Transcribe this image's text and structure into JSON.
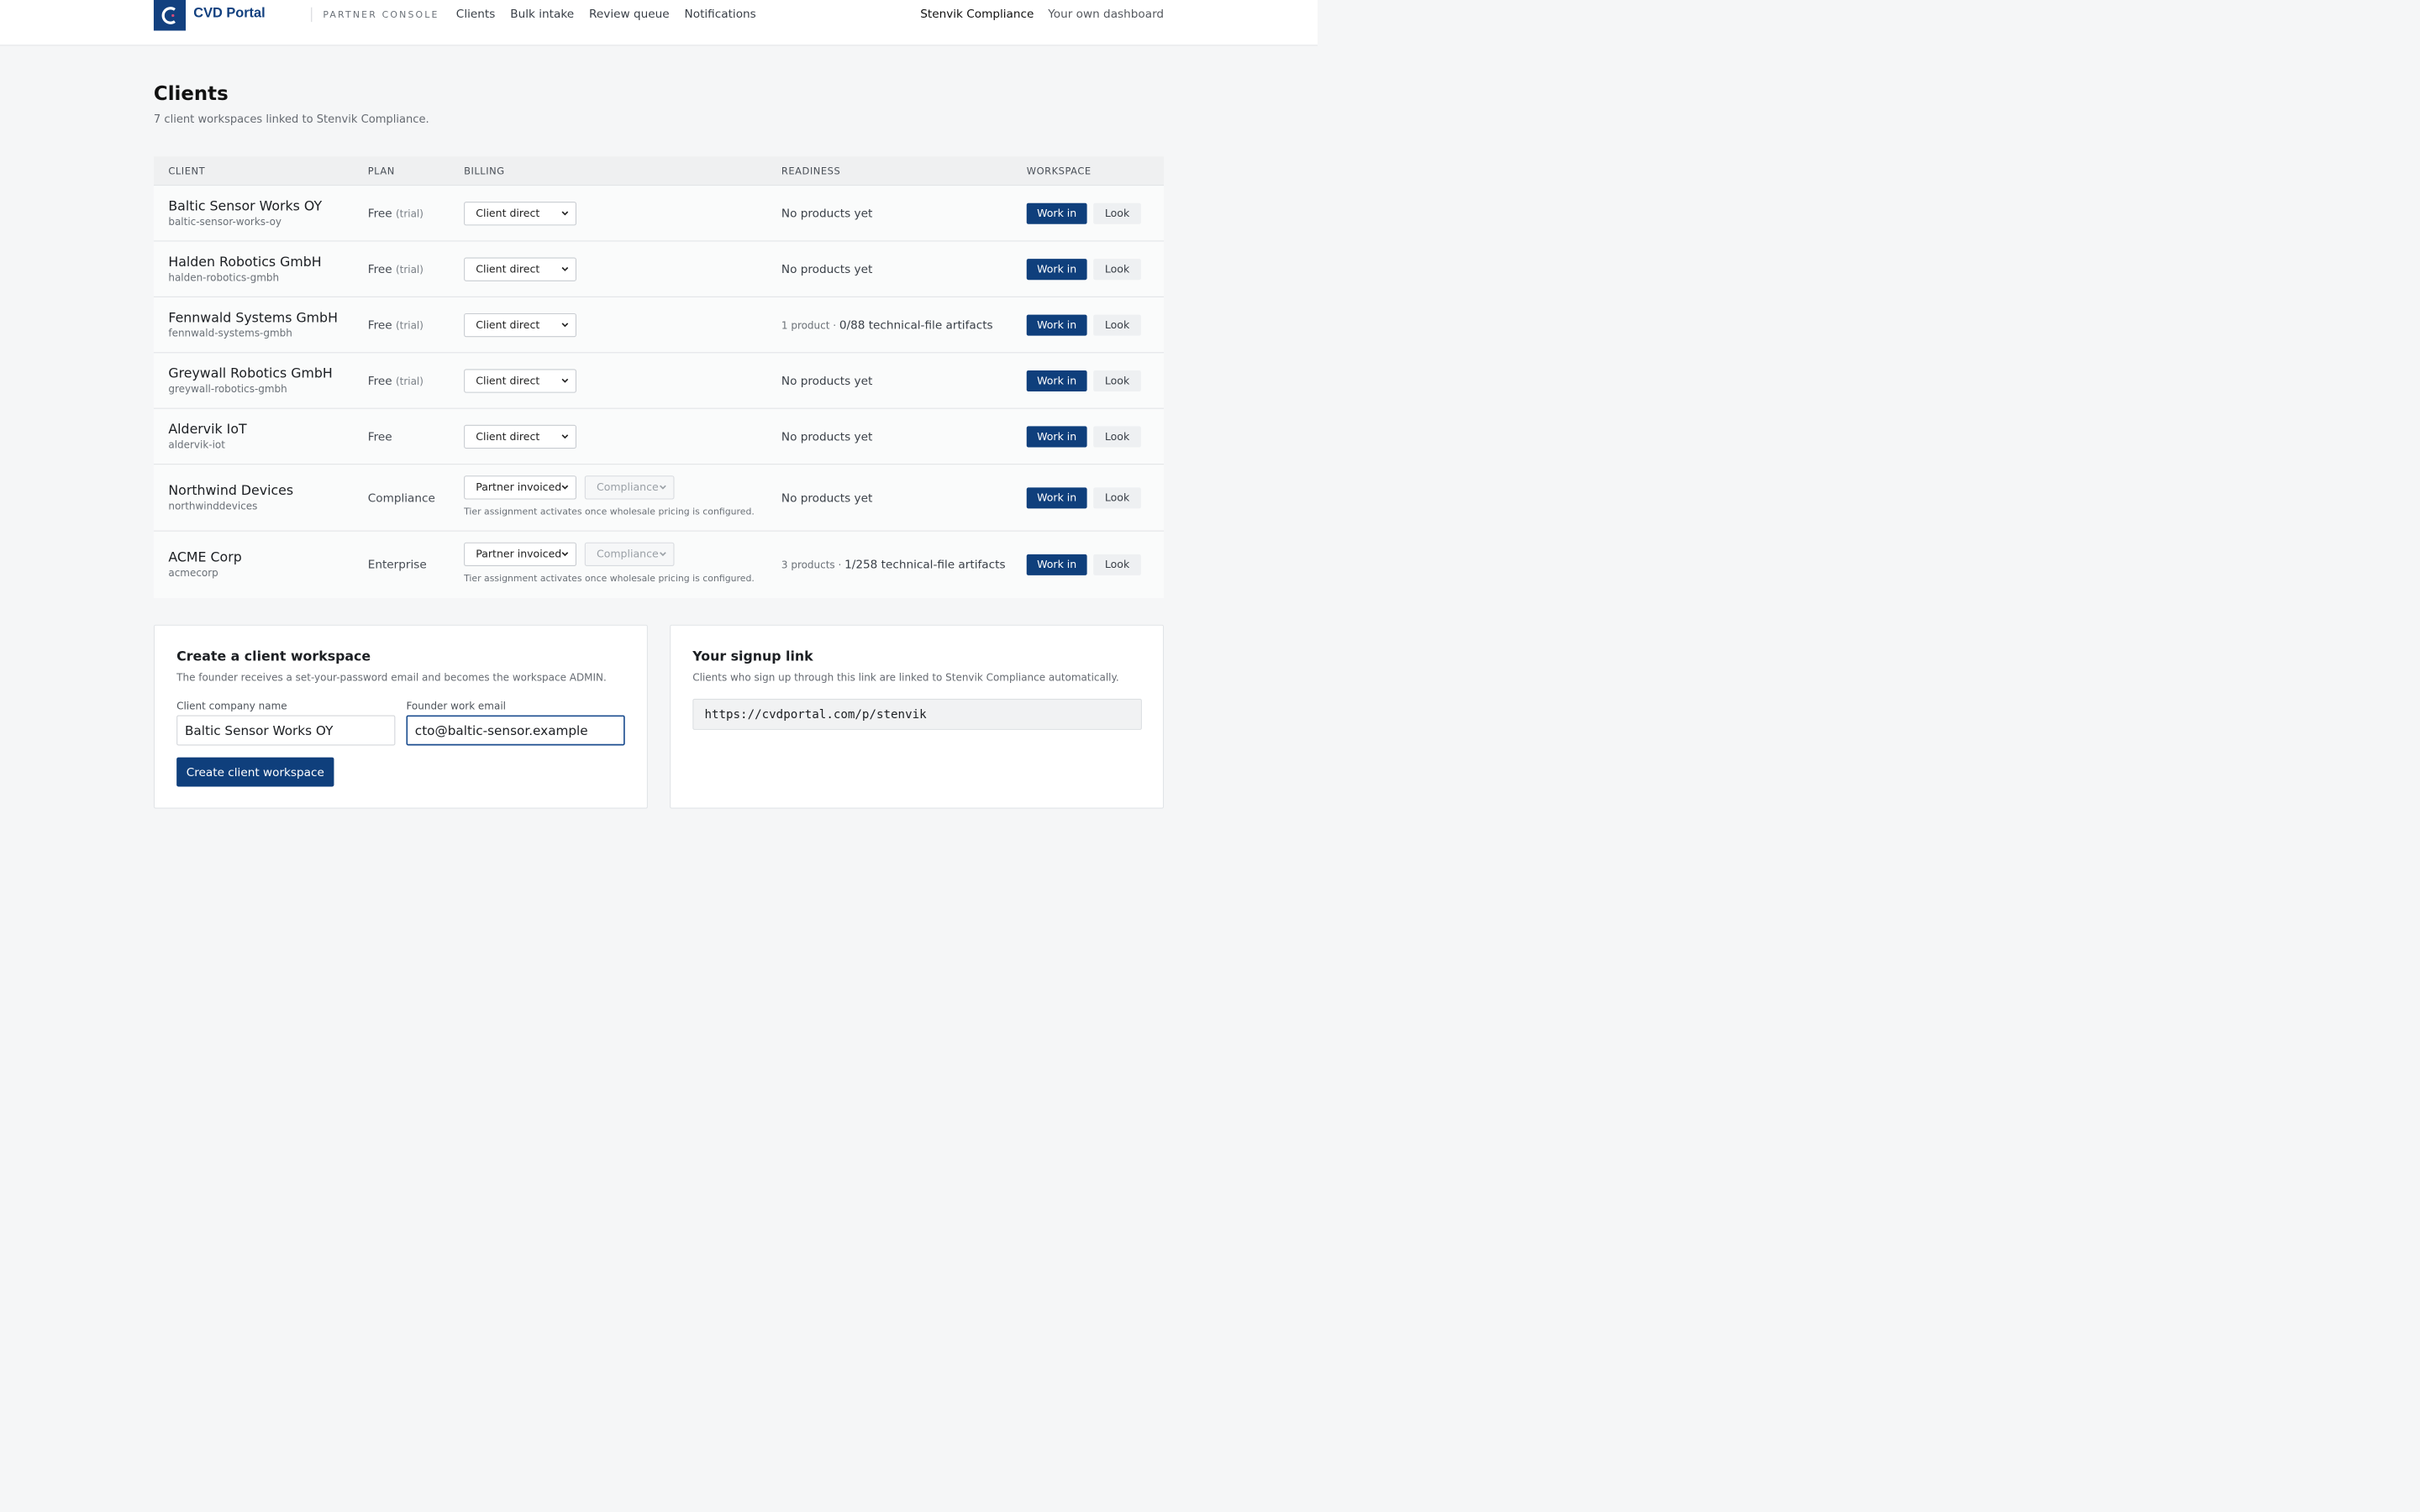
{
  "header": {
    "brand": "CVD Portal",
    "console_label": "PARTNER CONSOLE",
    "nav": [
      "Clients",
      "Bulk intake",
      "Review queue",
      "Notifications"
    ],
    "org_name": "Stenvik Compliance",
    "own_dashboard": "Your own dashboard",
    "brand_color": "#12407f"
  },
  "page": {
    "title": "Clients",
    "subtitle": "7 client workspaces linked to Stenvik Compliance."
  },
  "table": {
    "headers": {
      "client": "CLIENT",
      "plan": "PLAN",
      "billing": "BILLING",
      "readiness": "READINESS",
      "workspace": "WORKSPACE"
    },
    "work_label": "Work in",
    "look_label": "Look",
    "tier_note": "Tier assignment activates once wholesale pricing is configured.",
    "rows": [
      {
        "name": "Baltic Sensor Works OY",
        "slug": "baltic-sensor-works-oy",
        "plan": "Free",
        "plan_note": "(trial)",
        "billing": "Client direct",
        "tier": "",
        "ready_small": "",
        "ready": "No products yet"
      },
      {
        "name": "Halden Robotics GmbH",
        "slug": "halden-robotics-gmbh",
        "plan": "Free",
        "plan_note": "(trial)",
        "billing": "Client direct",
        "tier": "",
        "ready_small": "",
        "ready": "No products yet"
      },
      {
        "name": "Fennwald Systems GmbH",
        "slug": "fennwald-systems-gmbh",
        "plan": "Free",
        "plan_note": "(trial)",
        "billing": "Client direct",
        "tier": "",
        "ready_small": "1 product · ",
        "ready": "0/88 technical-file artifacts"
      },
      {
        "name": "Greywall Robotics GmbH",
        "slug": "greywall-robotics-gmbh",
        "plan": "Free",
        "plan_note": "(trial)",
        "billing": "Client direct",
        "tier": "",
        "ready_small": "",
        "ready": "No products yet"
      },
      {
        "name": "Aldervik IoT",
        "slug": "aldervik-iot",
        "plan": "Free",
        "plan_note": "",
        "billing": "Client direct",
        "tier": "",
        "ready_small": "",
        "ready": "No products yet"
      },
      {
        "name": "Northwind Devices",
        "slug": "northwinddevices",
        "plan": "Compliance",
        "plan_note": "",
        "billing": "Partner invoiced",
        "tier": "Compliance",
        "ready_small": "",
        "ready": "No products yet"
      },
      {
        "name": "ACME Corp",
        "slug": "acmecorp",
        "plan": "Enterprise",
        "plan_note": "",
        "billing": "Partner invoiced",
        "tier": "Compliance",
        "ready_small": "3 products · ",
        "ready": "1/258 technical-file artifacts"
      }
    ]
  },
  "create": {
    "title": "Create a client workspace",
    "desc": "The founder receives a set-your-password email and becomes the workspace ADMIN.",
    "company_label": "Client company name",
    "company_value": "Baltic Sensor Works OY",
    "email_label": "Founder work email",
    "email_value": "cto@baltic-sensor.example",
    "button": "Create client workspace"
  },
  "signup": {
    "title": "Your signup link",
    "desc": "Clients who sign up through this link are linked to Stenvik Compliance automatically.",
    "link": "https://cvdportal.com/p/stenvik"
  }
}
